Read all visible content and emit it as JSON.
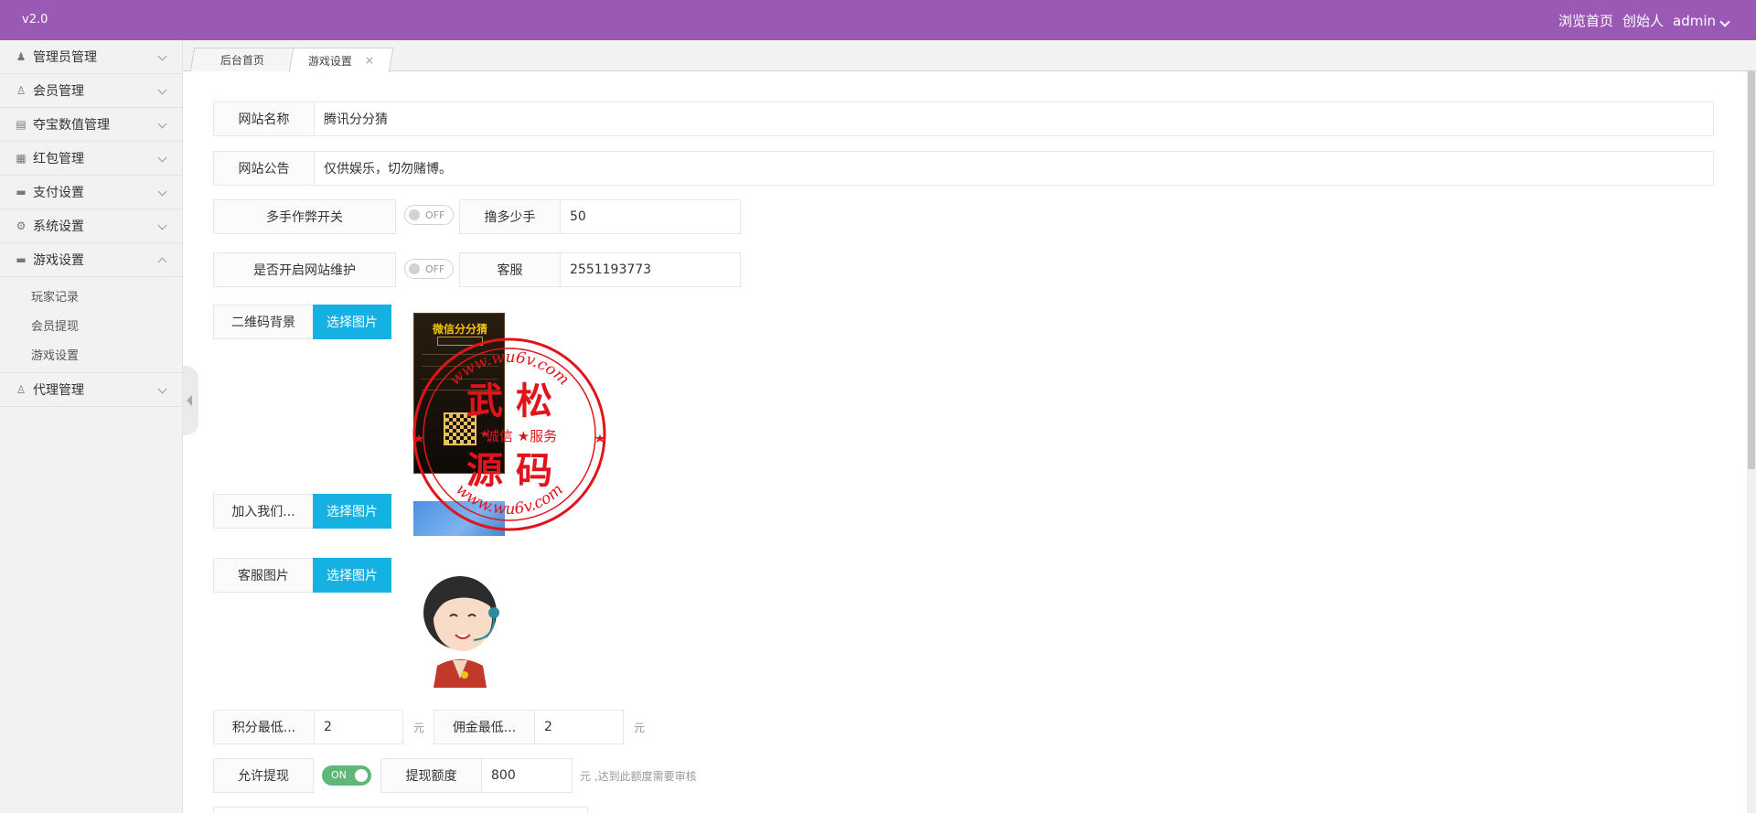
{
  "topbar": {
    "version": "v2.0",
    "browse_home": "浏览首页",
    "founder": "创始人",
    "user": "admin"
  },
  "sidebar": {
    "items": [
      {
        "label": "管理员管理",
        "icon": "user-icon"
      },
      {
        "label": "会员管理",
        "icon": "user-outline-icon"
      },
      {
        "label": "夺宝数值管理",
        "icon": "list-icon"
      },
      {
        "label": "红包管理",
        "icon": "book-icon"
      },
      {
        "label": "支付设置",
        "icon": "card-icon"
      },
      {
        "label": "系统设置",
        "icon": "gear-icon"
      },
      {
        "label": "游戏设置",
        "icon": "card-icon"
      },
      {
        "label": "代理管理",
        "icon": "user-outline-icon"
      }
    ],
    "sub_items": [
      "玩家记录",
      "会员提现",
      "游戏设置"
    ]
  },
  "tabs": {
    "home": "后台首页",
    "game_settings": "游戏设置",
    "close": "×"
  },
  "form": {
    "site_name_label": "网站名称",
    "site_name_value": "腾讯分分猜",
    "notice_label": "网站公告",
    "notice_value": "仅供娱乐，切勿赌博。",
    "multi_cheat_label": "多手作弊开关",
    "multi_cheat_state": "OFF",
    "how_many_label": "撸多少手",
    "how_many_value": "50",
    "maintenance_label": "是否开启网站维护",
    "maintenance_state": "OFF",
    "service_label": "客服",
    "service_value": "2551193773",
    "qr_bg_label": "二维码背景",
    "choose_image": "选择图片",
    "join_label": "加入我们...",
    "service_img_label": "客服图片",
    "min_points_label": "积分最低...",
    "min_points_value": "2",
    "min_commission_label": "佣金最低...",
    "min_commission_value": "2",
    "unit_yuan": "元",
    "allow_withdraw_label": "允许提现",
    "allow_withdraw_state": "ON",
    "withdraw_amount_label": "提现额度",
    "withdraw_amount_value": "800",
    "withdraw_hint": "元 ,达到此额度需要审核"
  },
  "poster": {
    "title": "微信分分猜"
  },
  "watermark": {
    "top_text": "www.wu6v.com",
    "name_top": "武 松",
    "middle": "诚信 ★服务",
    "name_bottom": "源 码",
    "bottom_text": "www.wu6v.com"
  },
  "colors": {
    "topbar": "#9b59b6",
    "button": "#1e9fff",
    "switch_on": "#5fb878",
    "stamp": "#e0151b"
  }
}
